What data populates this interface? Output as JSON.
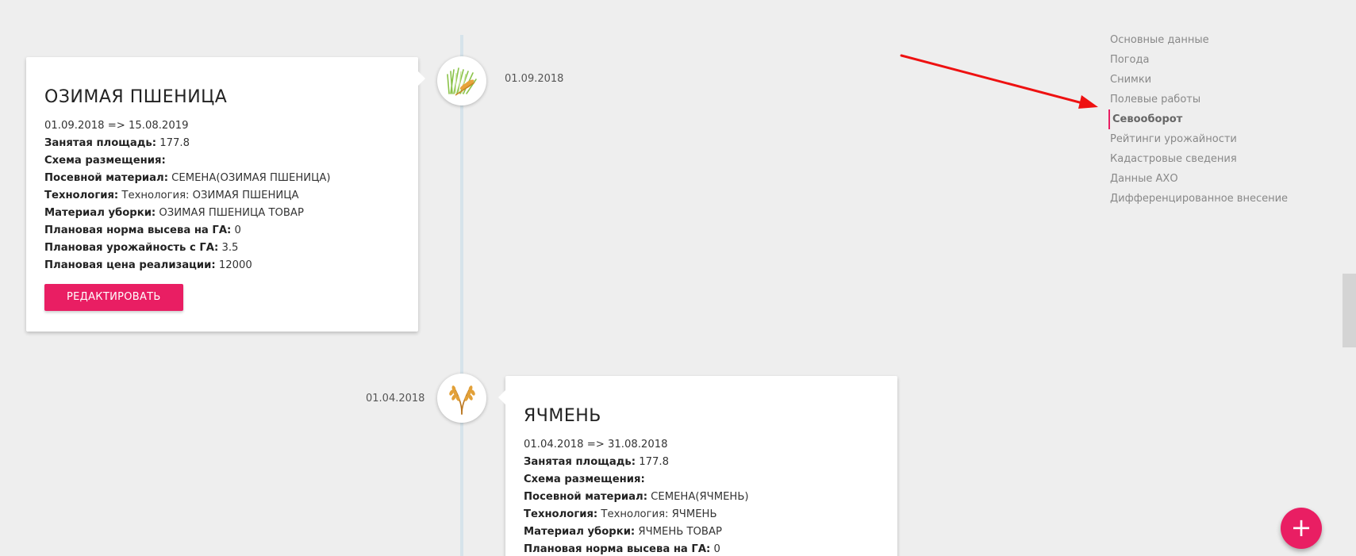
{
  "timeline": {
    "entries": [
      {
        "date": "01.09.2018",
        "icon": "wheat-green-icon",
        "card": {
          "title": "ОЗИМАЯ ПШЕНИЦА",
          "period": "01.09.2018 => 15.08.2019",
          "rows": [
            {
              "label": "Занятая площадь:",
              "value": " 177.8"
            },
            {
              "label": "Схема размещения:",
              "value": ""
            },
            {
              "label": "Посевной материал:",
              "value": " СЕМЕНА(ОЗИМАЯ ПШЕНИЦА)"
            },
            {
              "label": "Технология:",
              "value": " Технология: ОЗИМАЯ ПШЕНИЦА"
            },
            {
              "label": "Материал уборки:",
              "value": " ОЗИМАЯ ПШЕНИЦА ТОВАР"
            },
            {
              "label": "Плановая норма высева на ГА:",
              "value": " 0"
            },
            {
              "label": "Плановая урожайность с ГА:",
              "value": " 3.5"
            },
            {
              "label": "Плановая цена реализации:",
              "value": " 12000"
            }
          ],
          "edit_label": "РЕДАКТИРОВАТЬ"
        }
      },
      {
        "date": "01.04.2018",
        "icon": "wheat-golden-icon",
        "card": {
          "title": "ЯЧМЕНЬ",
          "period": "01.04.2018 => 31.08.2018",
          "rows": [
            {
              "label": "Занятая площадь:",
              "value": " 177.8"
            },
            {
              "label": "Схема размещения:",
              "value": ""
            },
            {
              "label": "Посевной материал:",
              "value": " СЕМЕНА(ЯЧМЕНЬ)"
            },
            {
              "label": "Технология:",
              "value": " Технология: ЯЧМЕНЬ"
            },
            {
              "label": "Материал уборки:",
              "value": " ЯЧМЕНЬ ТОВАР"
            },
            {
              "label": "Плановая норма высева на ГА:",
              "value": " 0"
            }
          ]
        }
      }
    ]
  },
  "side_nav": {
    "items": [
      {
        "label": "Основные данные"
      },
      {
        "label": "Погода"
      },
      {
        "label": "Снимки"
      },
      {
        "label": "Полевые работы"
      },
      {
        "label": "Севооборот",
        "active": true
      },
      {
        "label": "Рейтинги урожайности"
      },
      {
        "label": "Кадастровые сведения"
      },
      {
        "label": "Данные АХО"
      },
      {
        "label": "Дифференцированное внесение"
      }
    ]
  },
  "fab": {
    "icon": "plus-icon",
    "label": "+"
  },
  "colors": {
    "accent": "#e91e63",
    "background": "#eeeeee",
    "timeline_line": "#d6e3ea",
    "annotation_arrow": "#ee1111"
  }
}
